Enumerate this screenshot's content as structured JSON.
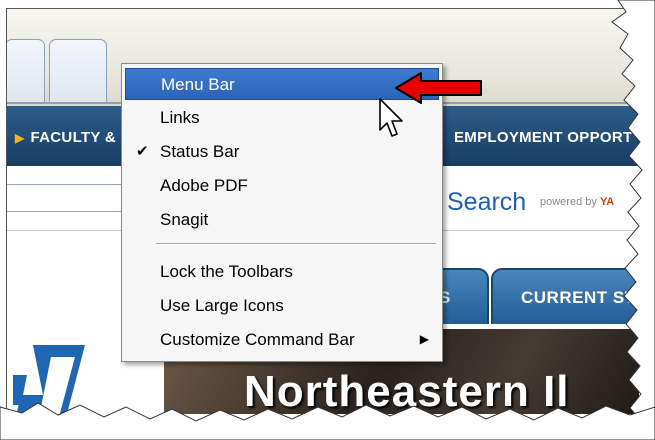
{
  "browser": {
    "nav_left": "FACULTY &",
    "nav_right": "EMPLOYMENT OPPORT",
    "search_word": "Search",
    "powered_by": "powered by",
    "powered_brand": "YA",
    "content_tab_1": "S",
    "content_tab_2": "CURRENT ST",
    "hero_text": "Northeastern Il"
  },
  "context_menu": {
    "items": [
      {
        "label": "Menu Bar",
        "highlighted": true,
        "checked": false
      },
      {
        "label": "Links",
        "highlighted": false,
        "checked": false
      },
      {
        "label": "Status Bar",
        "highlighted": false,
        "checked": true
      },
      {
        "label": "Adobe PDF",
        "highlighted": false,
        "checked": false
      },
      {
        "label": "Snagit",
        "highlighted": false,
        "checked": false
      },
      {
        "label": "Lock the Toolbars",
        "highlighted": false,
        "checked": false
      },
      {
        "label": "Use Large Icons",
        "highlighted": false,
        "checked": false
      },
      {
        "label": "Customize Command Bar",
        "highlighted": false,
        "checked": false,
        "submenu": true
      }
    ],
    "check_glyph": "✔",
    "submenu_glyph": "▶"
  },
  "colors": {
    "highlight": "#3d7bd0",
    "nav_band": "#1f4a74",
    "accent_arrow": "#e60000"
  },
  "icons": [
    "check-icon",
    "submenu-arrow-icon",
    "red-pointer-arrow",
    "mouse-cursor-icon",
    "university-logo"
  ]
}
